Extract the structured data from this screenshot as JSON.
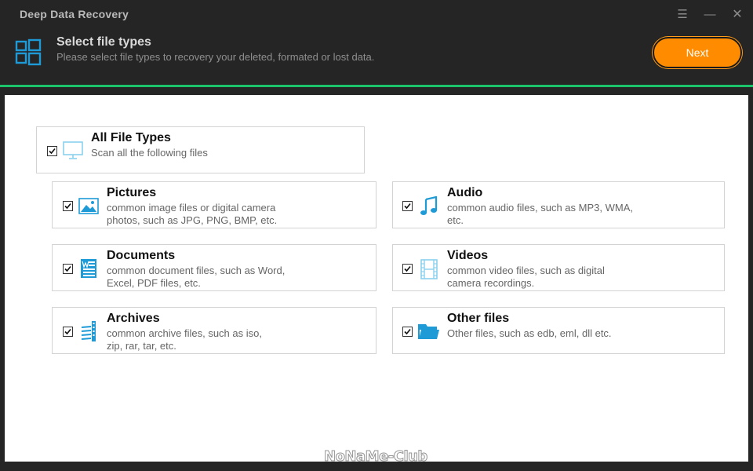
{
  "app": {
    "title": "Deep Data Recovery"
  },
  "window_controls": {
    "settings_glyph": "☰",
    "minimize_glyph": "—",
    "close_glyph": "✕"
  },
  "header": {
    "title": "Select file types",
    "subtitle": "Please select file types to recovery your deleted, formated or lost data.",
    "next_label": "Next",
    "icon": "windows-grid-icon"
  },
  "colors": {
    "accent_orange": "#ff8c00",
    "accent_green": "#1dc36a",
    "icon_blue": "#1e9bd7"
  },
  "all_types": {
    "title": "All File Types",
    "desc": "Scan all the following files",
    "checked": true,
    "icon": "monitor-icon"
  },
  "types": [
    {
      "title": "Pictures",
      "desc1": "common image files or digital camera",
      "desc2": "photos, such as JPG, PNG, BMP, etc.",
      "checked": true,
      "icon": "picture-icon"
    },
    {
      "title": "Audio",
      "desc1": "common audio files, such as MP3, WMA,",
      "desc2": "etc.",
      "checked": true,
      "icon": "music-note-icon"
    },
    {
      "title": "Documents",
      "desc1": "common document files, such as Word,",
      "desc2": "Excel, PDF files, etc.",
      "checked": true,
      "icon": "word-document-icon"
    },
    {
      "title": "Videos",
      "desc1": "common video files, such as digital",
      "desc2": "camera recordings.",
      "checked": true,
      "icon": "film-icon"
    },
    {
      "title": "Archives",
      "desc1": "common archive files, such as iso,",
      "desc2": "zip, rar, tar, etc.",
      "checked": true,
      "icon": "archive-icon"
    },
    {
      "title": "Other files",
      "desc1": "Other files, such as edb, eml, dll etc.",
      "desc2": "",
      "checked": true,
      "icon": "folder-icon"
    }
  ],
  "watermark": "NoNaMe-Club"
}
